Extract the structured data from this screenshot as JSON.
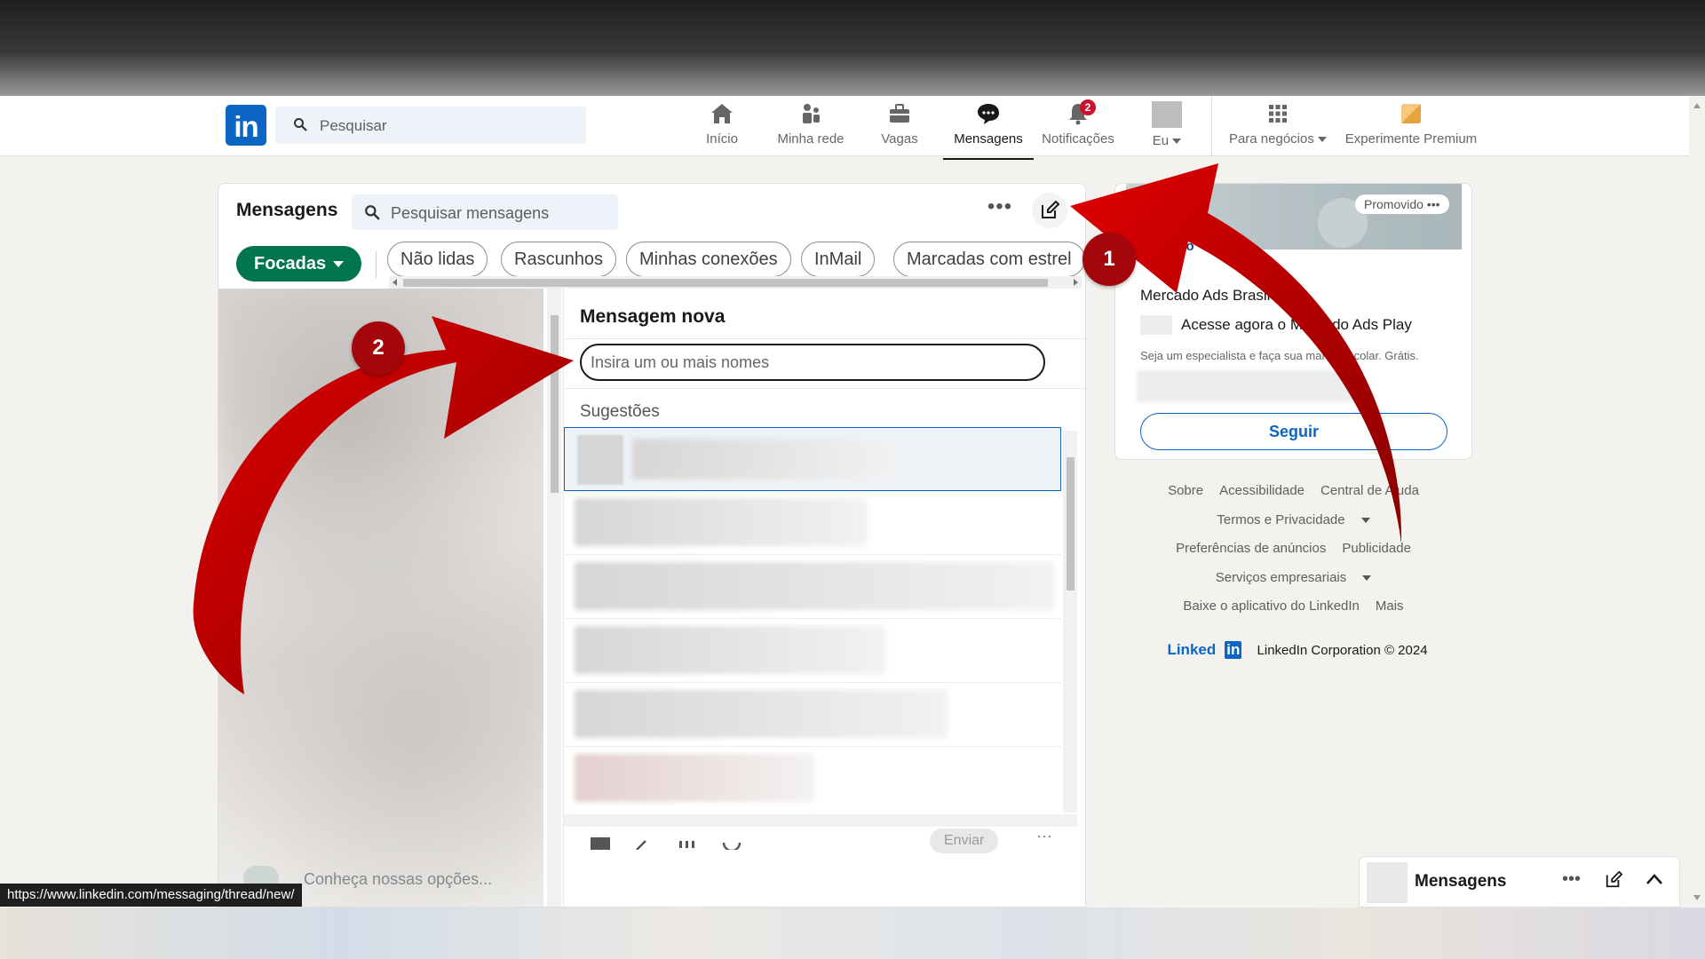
{
  "navbar": {
    "logo": "in",
    "search_placeholder": "Pesquisar",
    "items": [
      {
        "label": "Início",
        "icon": "home-icon"
      },
      {
        "label": "Minha rede",
        "icon": "network-icon"
      },
      {
        "label": "Vagas",
        "icon": "jobs-icon"
      },
      {
        "label": "Mensagens",
        "icon": "messaging-icon",
        "active": true
      },
      {
        "label": "Notificações",
        "icon": "bell-icon",
        "badge": "2"
      },
      {
        "label": "Eu",
        "icon": "avatar"
      },
      {
        "label": "Para negócios",
        "icon": "grid-icon"
      },
      {
        "label": "Experimente Premium",
        "icon": "premium-icon"
      }
    ]
  },
  "messaging": {
    "title": "Mensagens",
    "search_placeholder": "Pesquisar mensagens",
    "more_label": "•••",
    "filters": {
      "primary": "Focadas",
      "pills": [
        "Não lidas",
        "Rascunhos",
        "Minhas conexões",
        "InMail",
        "Marcadas com estrel"
      ]
    },
    "list_teaser": "Conheça nossas opções..."
  },
  "compose": {
    "title": "Mensagem nova",
    "to_placeholder": "Insira um ou mais nomes",
    "suggestions_title": "Sugestões",
    "send_label": "Enviar",
    "toolbar_icons": [
      "image-icon",
      "attach-icon",
      "gif-icon",
      "emoji-icon"
    ]
  },
  "ad": {
    "promoted_label": "Promovido •••",
    "logo_text": "ado",
    "name": "Mercado Ads Brasil",
    "line": "Acesse agora o Mercado Ads Play",
    "description": "Seja um especialista e faça sua marca decolar. Grátis.",
    "follow_label": "Seguir"
  },
  "footer": {
    "row1": [
      "Sobre",
      "Acessibilidade",
      "Central de Ajuda"
    ],
    "row2": "Termos e Privacidade",
    "row3": [
      "Preferências de anúncios",
      "Publicidade"
    ],
    "row4": "Serviços empresariais",
    "row5": [
      "Baixe o aplicativo do LinkedIn",
      "Mais"
    ],
    "brand_text": "Linked",
    "brand_box": "in",
    "copyright": "LinkedIn Corporation © 2024"
  },
  "mini_messaging": {
    "title": "Mensagens",
    "more_label": "•••"
  },
  "status_url": "https://www.linkedin.com/messaging/thread/new/",
  "annotations": {
    "step1": "1",
    "step2": "2",
    "arrow_color": "#c00000"
  }
}
